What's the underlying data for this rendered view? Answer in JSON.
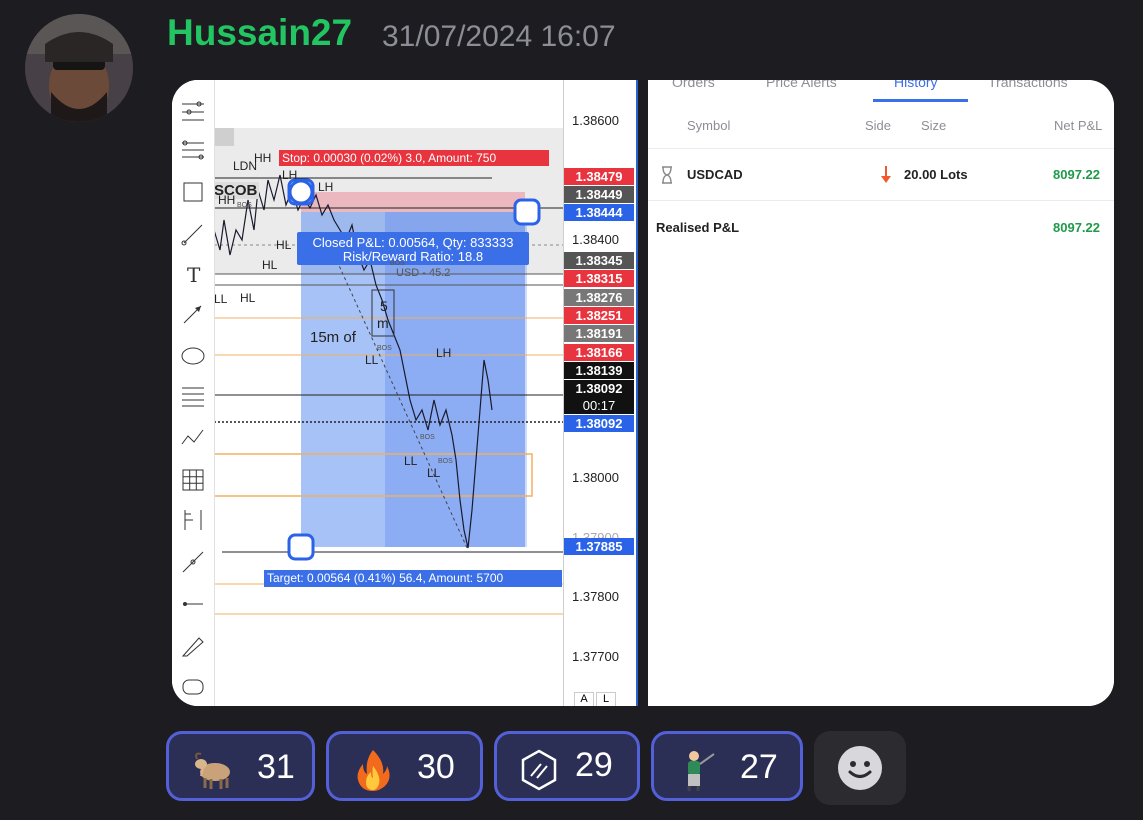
{
  "message": {
    "username": "Hussain27",
    "timestamp": "31/07/2024 16:07"
  },
  "chart": {
    "stop_label": "Stop: 0.00030 (0.02%) 3.0, Amount: 750",
    "target_label": "Target: 0.00564 (0.41%) 56.4, Amount: 5700",
    "closed_label_line1": "Closed P&L: 0.00564, Qty: 833333",
    "closed_label_line2": "Risk/Reward Ratio: 18.8",
    "usd_label": "USD - 45.2",
    "interval_label": "15m of",
    "annotations": {
      "ldn": "LDN",
      "hh1": "HH",
      "scob": "SCOB",
      "hh2": "HH",
      "lh1": "LH",
      "lh2": "LH",
      "hl1": "HL",
      "hl2": "HL",
      "hl3": "HL",
      "ll1": "LL",
      "ll2": "LL",
      "ll3": "LL",
      "ll4": "LL",
      "lh3": "LH",
      "bos1": "BOS",
      "bos2": "BOS",
      "bos3": "BOS",
      "bos4": "BOS",
      "bos5": "BOS",
      "box_s": "5",
      "box_m": "m"
    },
    "price_labels": [
      "1.38600",
      "1.38400",
      "1.38000",
      "1.37800",
      "1.37700",
      "1.37900"
    ],
    "price_badges": [
      {
        "value": "1.38479",
        "color": "#e8343e"
      },
      {
        "value": "1.38449",
        "color": "#555555"
      },
      {
        "value": "1.38444",
        "color": "#2a63e8"
      },
      {
        "value": "1.38345",
        "color": "#555555"
      },
      {
        "value": "1.38315",
        "color": "#e8343e"
      },
      {
        "value": "1.38276",
        "color": "#777777"
      },
      {
        "value": "1.38251",
        "color": "#e8343e"
      },
      {
        "value": "1.38191",
        "color": "#777777"
      },
      {
        "value": "1.38166",
        "color": "#e8343e"
      },
      {
        "value": "1.38139",
        "color": "#111111"
      },
      {
        "value": "1.38092",
        "color": "#111111"
      },
      {
        "value": "00:17",
        "color": "#111111"
      },
      {
        "value": "1.38092",
        "color": "#2a63e8"
      },
      {
        "value": "1.37885",
        "color": "#2a63e8"
      }
    ],
    "axis_buttons": [
      "A",
      "L"
    ]
  },
  "history": {
    "tabs": [
      "Orders",
      "Price Alerts",
      "History",
      "Transactions"
    ],
    "active_tab": "History",
    "columns": {
      "symbol": "Symbol",
      "side": "Side",
      "size": "Size",
      "net": "Net P&L"
    },
    "row": {
      "symbol": "USDCAD",
      "size": "20.00 Lots",
      "net": "8097.22",
      "side_icon": "arrow-down-icon"
    },
    "realised_label": "Realised P&L",
    "realised_value": "8097.22"
  },
  "reactions": [
    {
      "emoji": "goat-emoji",
      "count": "31"
    },
    {
      "emoji": "fire-emoji",
      "count": "30"
    },
    {
      "emoji": "custom-hex-emoji",
      "count": "29"
    },
    {
      "emoji": "golfer-emoji",
      "count": "27"
    }
  ],
  "colors": {
    "username": "#23c562",
    "reaction_border": "#5360d8",
    "net_pnl": "#1f9a4a"
  }
}
